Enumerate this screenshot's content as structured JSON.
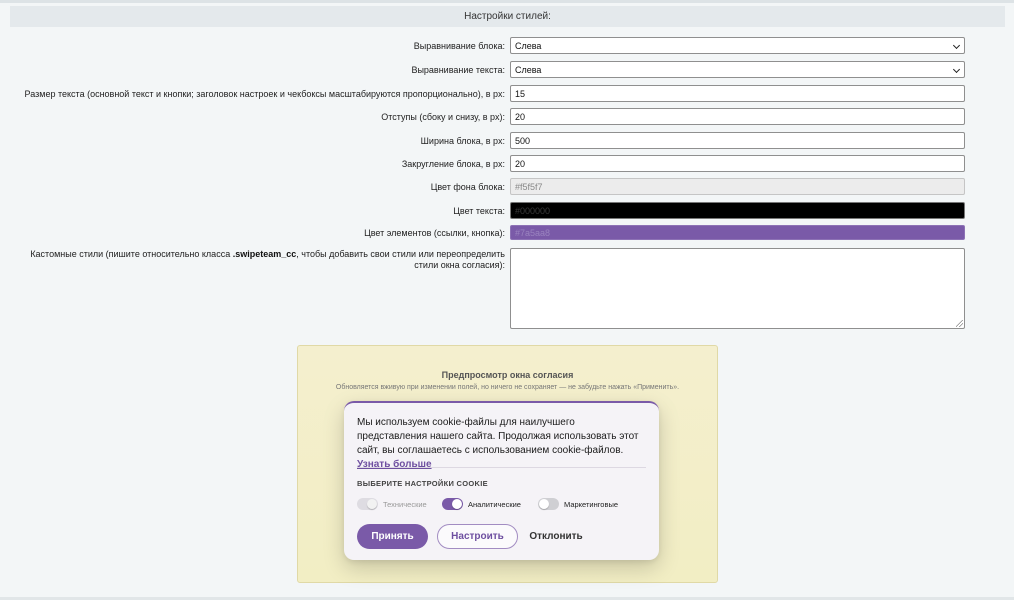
{
  "section": {
    "title": "Настройки стилей:"
  },
  "form": {
    "block_align": {
      "label": "Выравнивание блока:",
      "value": "Слева"
    },
    "text_align": {
      "label": "Выравнивание текста:",
      "value": "Слева"
    },
    "font_size": {
      "label": "Размер текста (основной текст и кнопки; заголовок настроек и чекбоксы масштабируются пропорционально), в px:",
      "value": "15"
    },
    "padding": {
      "label": "Отступы (сбоку и снизу, в px):",
      "value": "20"
    },
    "width": {
      "label": "Ширина блока, в px:",
      "value": "500"
    },
    "radius": {
      "label": "Закругление блока, в px:",
      "value": "20"
    },
    "bg_color": {
      "label": "Цвет фона блока:",
      "value": "#f5f5f7",
      "color": "#ececec"
    },
    "text_color": {
      "label": "Цвет текста:",
      "value": "#000000",
      "color": "#000000"
    },
    "elements_color": {
      "label": "Цвет элементов (ссылки, кнопка):",
      "value": "#7a5aa8",
      "color": "#7a5aa8"
    },
    "custom_css": {
      "label_before": "Кастомные стили (пишите относительно класса ",
      "label_class": ".swipeteam_cc",
      "label_after": ", чтобы добавить свои стили или переопределить стили окна согласия):",
      "value": ""
    }
  },
  "preview": {
    "title": "Предпросмотр окна согласия",
    "subtitle": "Обновляется вживую при изменении полей, но ничего не сохраняет — не забудьте нажать «Применить».",
    "cookie": {
      "text": "Мы используем cookie-файлы для наилучшего представления нашего сайта. Продолжая использовать этот сайт, вы соглашаетесь с использованием cookie-файлов.",
      "link": "Узнать больше",
      "settings_title": "ВЫБЕРИТЕ НАСТРОЙКИ COOKIE",
      "toggles": [
        {
          "label": "Технические",
          "state": "disabled"
        },
        {
          "label": "Аналитические",
          "state": "on"
        },
        {
          "label": "Маркетинговые",
          "state": "off"
        }
      ],
      "buttons": {
        "accept": "Принять",
        "settings": "Настроить",
        "decline": "Отклонить"
      }
    }
  },
  "colors": {
    "accent": "#7a5aa8",
    "preview_bg": "#f2eec4"
  }
}
